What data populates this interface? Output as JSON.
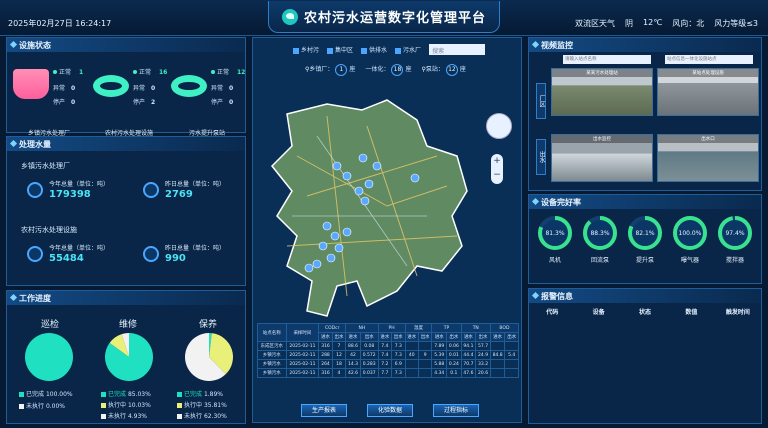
{
  "header": {
    "datetime": "2025年02月27日 16:24:17",
    "title": "农村污水运营数字化管理平台",
    "weather": {
      "district": "双流区天气",
      "condition": "阴",
      "temp": "12℃",
      "wind_dir": "风向：北",
      "wind_level": "风力等级≤3"
    }
  },
  "facility": {
    "title": "设施状态",
    "items": [
      {
        "label": "乡镇污水处理厂",
        "normal_label": "正常",
        "normal": "1",
        "abnormal_label": "异常",
        "abnormal": "0",
        "stopped_label": "停产",
        "stopped": "0"
      },
      {
        "label": "农村污水处理设施",
        "normal_label": "正常",
        "normal": "16",
        "abnormal_label": "异常",
        "abnormal": "0",
        "stopped_label": "停产",
        "stopped": "2"
      },
      {
        "label": "污水提升泵站",
        "normal_label": "正常",
        "normal": "12",
        "abnormal_label": "异常",
        "abnormal": "0",
        "stopped_label": "停产",
        "stopped": "0"
      }
    ]
  },
  "water": {
    "title": "处理水量",
    "groups": [
      {
        "name": "乡镇污水处理厂",
        "today_label": "今年总量（单位：吨）",
        "today": "179398",
        "yesterday_label": "昨日总量（单位：吨）",
        "yesterday": "2769"
      },
      {
        "name": "农村污水处理设施",
        "today_label": "今年总量（单位：吨）",
        "today": "55484",
        "yesterday_label": "昨日总量（单位：吨）",
        "yesterday": "990"
      }
    ]
  },
  "progress": {
    "title": "工作进度",
    "items": [
      {
        "name": "巡检",
        "done": "已完成",
        "done_pct": "100.00%",
        "doing": "",
        "doing_pct": "",
        "todo": "未执行",
        "todo_pct": "0.00%",
        "values": [
          100,
          0,
          0
        ]
      },
      {
        "name": "维修",
        "done": "已完成",
        "done_pct": "85.03%",
        "doing": "执行中",
        "doing_pct": "10.03%",
        "todo": "未执行",
        "todo_pct": "4.93%",
        "values": [
          85.03,
          10.03,
          4.93
        ]
      },
      {
        "name": "保养",
        "done": "已完成",
        "done_pct": "1.89%",
        "doing": "执行中",
        "doing_pct": "35.81%",
        "todo": "未执行",
        "todo_pct": "62.30%",
        "values": [
          1.89,
          35.81,
          62.3
        ]
      }
    ],
    "colors": {
      "done": "#1fe0c0",
      "doing": "#e8f07a",
      "todo": "#f2f2f2"
    }
  },
  "map": {
    "filters": [
      "乡村污",
      "集中区",
      "供排水",
      "污水厂"
    ],
    "search_placeholder": "搜索",
    "counts": [
      {
        "label": "乡镇厂：",
        "value": "1",
        "unit": "座"
      },
      {
        "label": "一体化：",
        "value": "18",
        "unit": "座"
      },
      {
        "label": "泵站：",
        "value": "12",
        "unit": "座"
      }
    ],
    "zoom_in": "+",
    "zoom_out": "−"
  },
  "table": {
    "headers": [
      "站点名称",
      "采样时间",
      "CODcr",
      "NH",
      "PH",
      "温度",
      "TP",
      "TN",
      "BOD"
    ],
    "sub": [
      "进水",
      "出水",
      "进水",
      "出水",
      "进水",
      "出水",
      "进水",
      "出水",
      "进水",
      "出水",
      "进水",
      "出水",
      "进水",
      "出水"
    ],
    "rows": [
      [
        "东成区污水",
        "2025-02-11",
        "316",
        "7",
        "88.6",
        "0.08",
        "7.4",
        "7.3",
        "",
        "",
        "7.89",
        "0.06",
        "94.1",
        "57.7",
        "",
        ""
      ],
      [
        "乡镇污水",
        "2025-02-11",
        "288",
        "12",
        "42",
        "0.572",
        "7.4",
        "7.3",
        "40",
        "9",
        "5.39",
        "0.01",
        "44.4",
        "24.9",
        "84.8",
        "5.4"
      ],
      [
        "乡镇污水",
        "2025-02-11",
        "264",
        "18",
        "14.3",
        "0.283",
        "7.2",
        "6.9",
        "",
        "",
        "5.88",
        "0.24",
        "70.7",
        "33.2",
        "",
        ""
      ],
      [
        "乡镇污水",
        "2025-02-11",
        "316",
        "4",
        "42.6",
        "0.037",
        "7.7",
        "7.3",
        "",
        "",
        "4.34",
        "0.1",
        "47.6",
        "20.6",
        "",
        ""
      ]
    ]
  },
  "buttons": [
    "生产报表",
    "化验数据",
    "过程指标"
  ],
  "video": {
    "title": "视频监控",
    "tabs": [
      "厂区",
      "出水"
    ],
    "search_placeholder": "请输入站点名称",
    "search_placeholder2": "站点信息一体化设施站点",
    "feeds": [
      "某某污水处理站",
      "某站点处理设施",
      "出水监控",
      "出水口"
    ]
  },
  "equipment": {
    "title": "设备完好率",
    "items": [
      {
        "name": "风机",
        "value": "81.3%",
        "pct": 81.3
      },
      {
        "name": "回流泵",
        "value": "88.3%",
        "pct": 88.3
      },
      {
        "name": "提升泵",
        "value": "82.1%",
        "pct": 82.1
      },
      {
        "name": "曝气器",
        "value": "100.0%",
        "pct": 100
      },
      {
        "name": "搅拌器",
        "value": "97.4%",
        "pct": 97.4
      }
    ]
  },
  "alarm": {
    "title": "报警信息",
    "headers": [
      "代码",
      "设备",
      "状态",
      "数值",
      "触发时间"
    ]
  }
}
